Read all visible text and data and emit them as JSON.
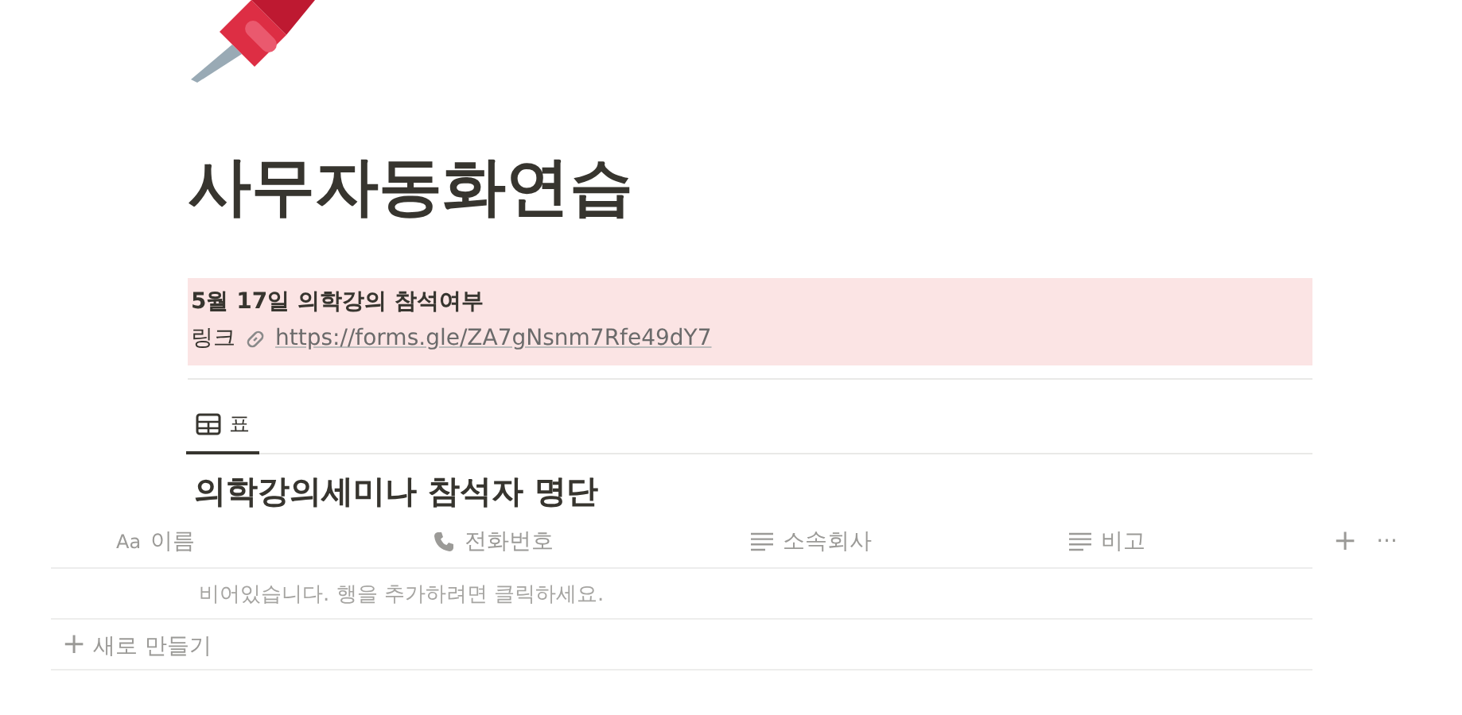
{
  "page": {
    "title": "사무자동화연습"
  },
  "callout": {
    "heading": "5월 17일 의학강의 참석여부",
    "label": "링크",
    "link": "https://forms.gle/ZA7gNsnm7Rfe49dY7"
  },
  "tabs": [
    {
      "label": "표",
      "selected": true
    }
  ],
  "database": {
    "title": "의학강의세미나 참석자 명단",
    "columns": [
      {
        "kind": "title",
        "icon_label": "Aa",
        "label": "이름"
      },
      {
        "kind": "phone",
        "label": "전화번호"
      },
      {
        "kind": "text",
        "label": "소속회사"
      },
      {
        "kind": "text",
        "label": "비고"
      }
    ],
    "add_column": "+",
    "more": "···",
    "empty_message": "비어있습니다. 행을 추가하려면 클릭하세요.",
    "new_row": {
      "icon": "+",
      "label": "새로 만들기"
    }
  }
}
